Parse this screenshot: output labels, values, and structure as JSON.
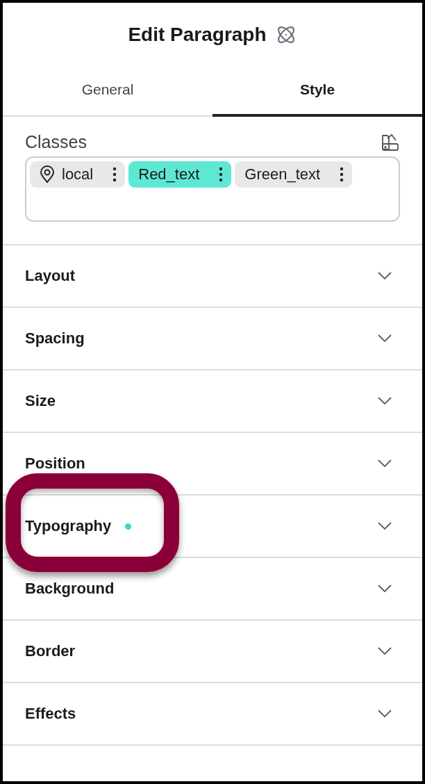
{
  "title": "Edit Paragraph",
  "tabs": [
    {
      "label": "General",
      "selected": false
    },
    {
      "label": "Style",
      "selected": true
    }
  ],
  "classes": {
    "label": "Classes",
    "chips": [
      {
        "label": "local",
        "kind": "local",
        "selected": false
      },
      {
        "label": "Red_text",
        "kind": "class",
        "selected": true
      },
      {
        "label": "Green_text",
        "kind": "class",
        "selected": false
      }
    ]
  },
  "sections": [
    {
      "label": "Layout",
      "modified": false,
      "highlighted": false
    },
    {
      "label": "Spacing",
      "modified": false,
      "highlighted": false
    },
    {
      "label": "Size",
      "modified": false,
      "highlighted": false
    },
    {
      "label": "Position",
      "modified": false,
      "highlighted": false
    },
    {
      "label": "Typography",
      "modified": true,
      "highlighted": true
    },
    {
      "label": "Background",
      "modified": false,
      "highlighted": false
    },
    {
      "label": "Border",
      "modified": false,
      "highlighted": false
    },
    {
      "label": "Effects",
      "modified": false,
      "highlighted": false
    }
  ]
}
